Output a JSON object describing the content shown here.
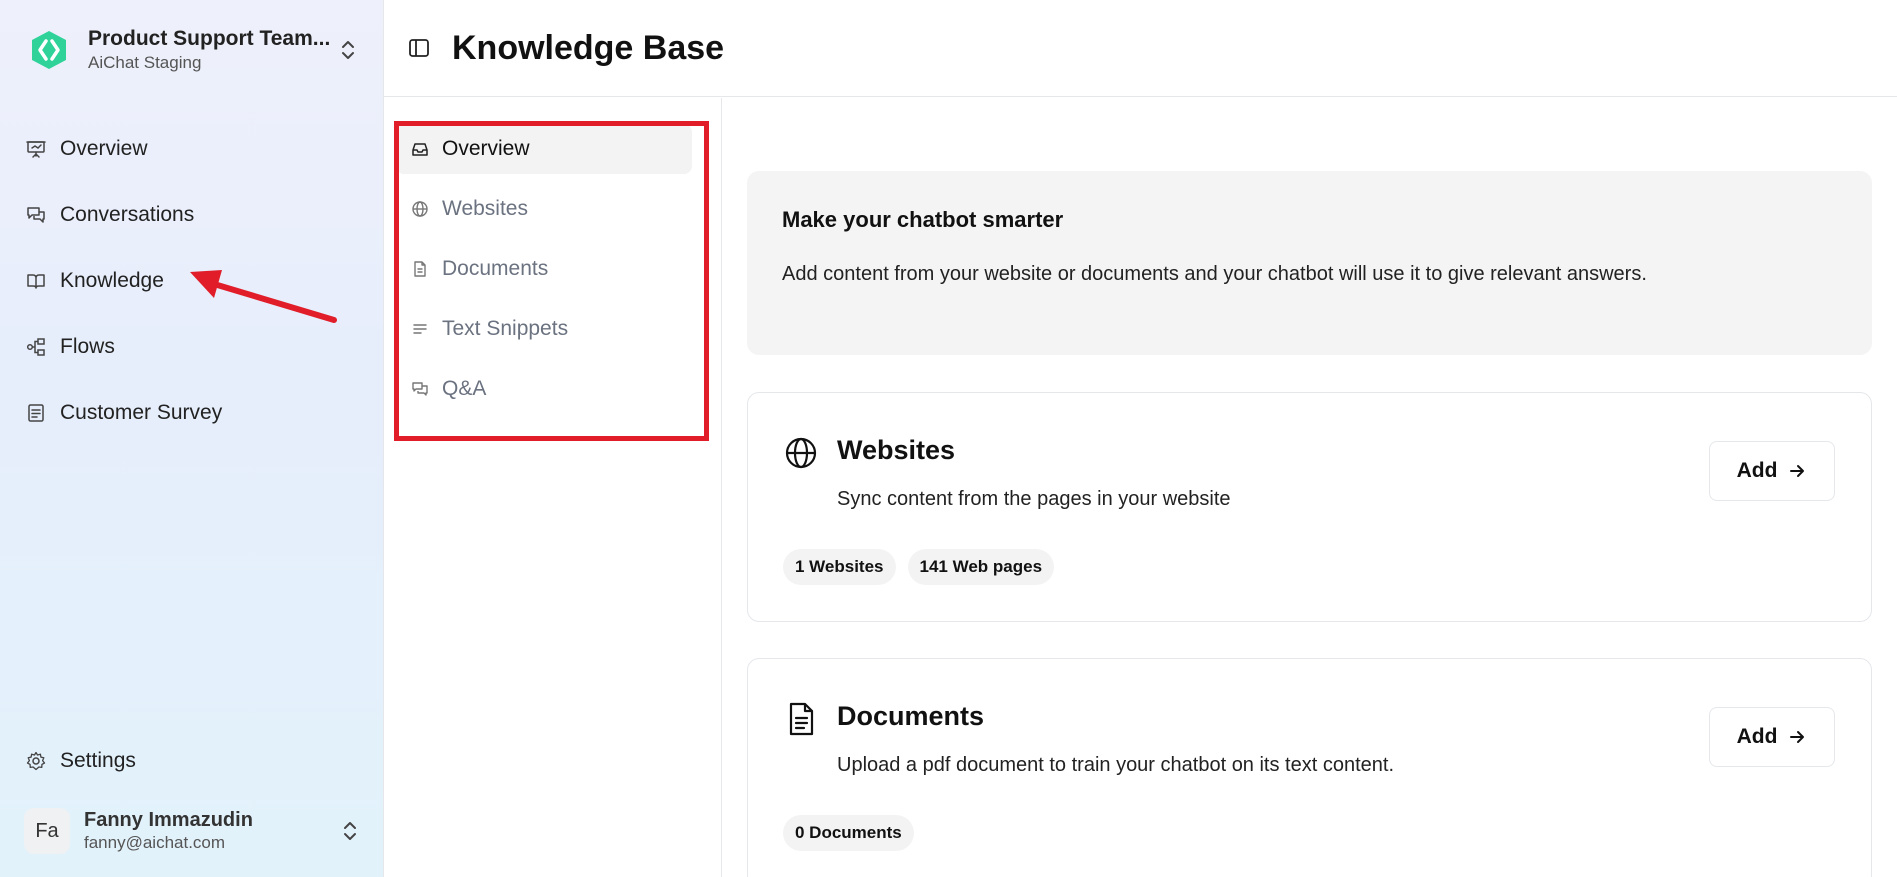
{
  "workspace": {
    "name": "Product Support Team...",
    "subtitle": "AiChat Staging"
  },
  "sidebar": {
    "items": [
      {
        "label": "Overview",
        "icon": "presentation-icon"
      },
      {
        "label": "Conversations",
        "icon": "chat-bubbles-icon"
      },
      {
        "label": "Knowledge",
        "icon": "book-icon"
      },
      {
        "label": "Flows",
        "icon": "flow-icon"
      },
      {
        "label": "Customer Survey",
        "icon": "survey-icon"
      }
    ],
    "settings_label": "Settings"
  },
  "user": {
    "initials": "Fa",
    "name": "Fanny Immazudin",
    "email": "fanny@aichat.com"
  },
  "header": {
    "title": "Knowledge Base"
  },
  "subnav": {
    "items": [
      {
        "label": "Overview",
        "icon": "inbox-icon",
        "active": true
      },
      {
        "label": "Websites",
        "icon": "globe-icon"
      },
      {
        "label": "Documents",
        "icon": "document-icon"
      },
      {
        "label": "Text Snippets",
        "icon": "lines-icon"
      },
      {
        "label": "Q&A",
        "icon": "qa-icon"
      }
    ]
  },
  "intro": {
    "title": "Make your chatbot smarter",
    "description": "Add content from your website or documents and your chatbot will use it to give relevant answers."
  },
  "cards": {
    "websites": {
      "title": "Websites",
      "description": "Sync content from the pages in your website",
      "badges": [
        "1 Websites",
        "141 Web pages"
      ],
      "add_label": "Add"
    },
    "documents": {
      "title": "Documents",
      "description": "Upload a pdf document to train your chatbot on its text content.",
      "badges": [
        "0 Documents"
      ],
      "add_label": "Add"
    }
  },
  "colors": {
    "brand": "#2fd39a",
    "annotation": "#e11d2a"
  }
}
